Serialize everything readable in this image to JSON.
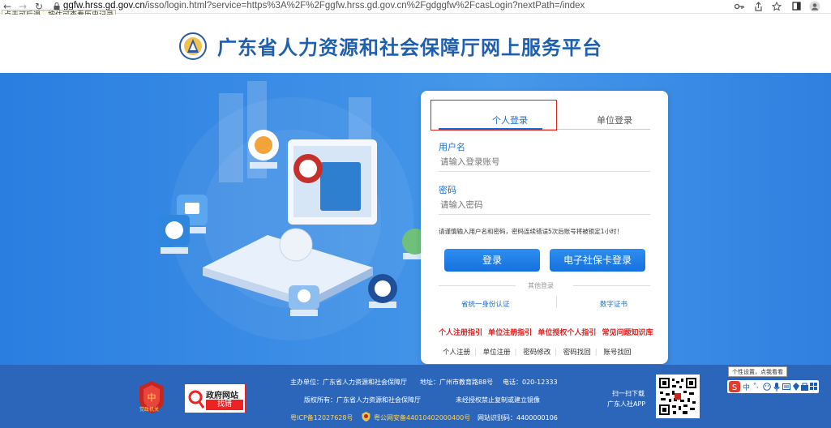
{
  "browser": {
    "nav_back": "←",
    "nav_forward": "→",
    "nav_reload": "↻",
    "url_host": "ggfw.hrss.gd.gov.cn",
    "url_path": "/isso/login.html?service=https%3A%2F%2Fggfw.hrss.gd.gov.cn%2Fgdggfw%2FcasLogin?nextPath=/index",
    "tooltip": "点击可后退，按住可查看历史记录",
    "icons": [
      "key-icon",
      "share-icon",
      "star-icon",
      "sidepanel-icon",
      "profile-icon"
    ]
  },
  "header": {
    "title": "广东省人力资源和社会保障厅网上服务平台"
  },
  "login": {
    "tab_personal": "个人登录",
    "tab_company": "单位登录",
    "username_label": "用户名",
    "username_placeholder": "请输入登录账号",
    "password_label": "密码",
    "password_placeholder": "请输入密码",
    "warning": "请谨慎输入用户名和密码，密码连续错误5次后账号将被锁定1小时！",
    "login_button": "登录",
    "card_login_button": "电子社保卡登录",
    "other_login": "其他登录",
    "other_methods": [
      "省统一身份认证",
      "数字证书"
    ],
    "guides": [
      "个人注册指引",
      "单位注册指引",
      "单位授权个人指引",
      "常见问题知识库"
    ],
    "bottom_links": [
      "个人注册",
      "单位注册",
      "密码修改",
      "密码找回",
      "账号找回"
    ]
  },
  "footer": {
    "host": "主办单位：广东省人力资源和社会保障厅",
    "address": "地址：广州市教育路88号",
    "phone": "电话：020-12333",
    "copyright": "版权所有：广东省人力资源和社会保障厅",
    "no_copy": "未经授权禁止复制或建立镜像",
    "icp": "粤ICP备12027628号",
    "police": "粤公网安备44010402000400号",
    "site_code": "网站识别码：4400000106",
    "app_line1": "扫一扫下载",
    "app_line2": "广东人社APP",
    "gov_badge_line1": "政府网站",
    "gov_badge_line2": "找错",
    "party_badge": "党政机关"
  },
  "ime": {
    "tip": "个性设置，点我看看",
    "lang": "中"
  },
  "colors": {
    "brand_blue": "#1a6fd6",
    "hero_blue": "#3d8fe6",
    "footer_blue": "#2b66ba",
    "guide_red": "#e02020"
  }
}
